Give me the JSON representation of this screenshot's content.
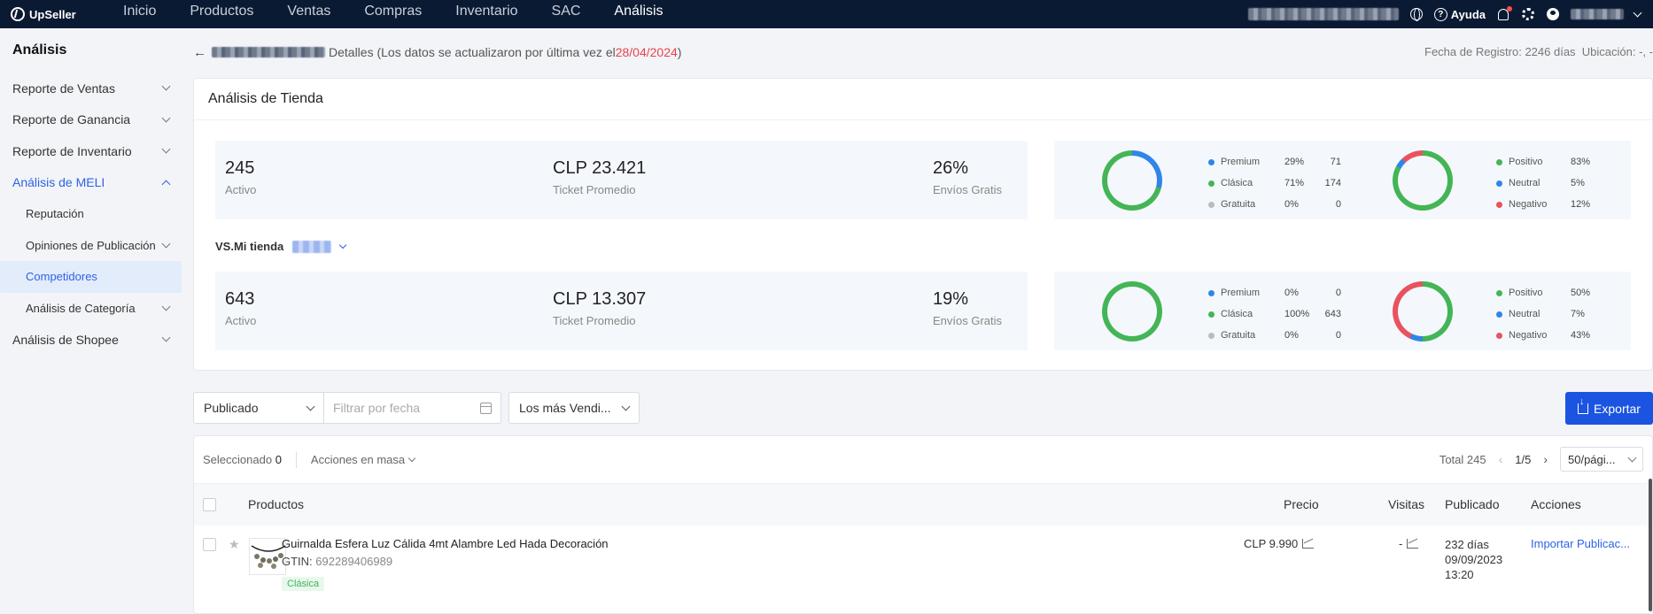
{
  "app": {
    "name": "UpSeller"
  },
  "nav": {
    "items": [
      "Inicio",
      "Productos",
      "Ventas",
      "Compras",
      "Inventario",
      "SAC",
      "Análisis"
    ],
    "active": "Análisis"
  },
  "top_right": {
    "help": "Ayuda"
  },
  "sidebar": {
    "title": "Análisis",
    "items": [
      {
        "label": "Reporte de Ventas"
      },
      {
        "label": "Reporte de Ganancia"
      },
      {
        "label": "Reporte de Inventario"
      },
      {
        "label": "Análisis de MELI"
      },
      {
        "label": "Reputación"
      },
      {
        "label": "Opiniones de Publicación"
      },
      {
        "label": "Competidores"
      },
      {
        "label": "Análisis de Categoría"
      },
      {
        "label": "Análisis de Shopee"
      }
    ]
  },
  "header": {
    "details_prefix": "Detalles (Los datos se actualizaron por última vez el ",
    "update_date": "28/04/2024",
    "details_suffix": ")",
    "registro": "Fecha de Registro: 2246 días",
    "ubicacion": "Ubicación: -, -"
  },
  "store": {
    "title": "Análisis de Tienda",
    "vs_label": "VS.Mi tienda",
    "competitor": {
      "active": "245",
      "active_label": "Activo",
      "ticket": "CLP 23.421",
      "ticket_label": "Ticket Promedio",
      "free": "26%",
      "free_label": "Envíos Gratis",
      "listing": [
        {
          "name": "Premium",
          "pct": "29%",
          "count": "71",
          "color": "#2f86e8"
        },
        {
          "name": "Clásica",
          "pct": "71%",
          "count": "174",
          "color": "#44b556"
        },
        {
          "name": "Gratuita",
          "pct": "0%",
          "count": "0",
          "color": "#bbbbbb"
        }
      ],
      "listing_fractions": [
        0.29,
        0.71,
        0
      ],
      "sentiment": [
        {
          "name": "Positivo",
          "pct": "83%",
          "color": "#44b556"
        },
        {
          "name": "Neutral",
          "pct": "5%",
          "color": "#2f86e8"
        },
        {
          "name": "Negativo",
          "pct": "12%",
          "color": "#e8535f"
        }
      ],
      "sentiment_fractions": [
        0.83,
        0.05,
        0.12
      ]
    },
    "mine": {
      "active": "643",
      "active_label": "Activo",
      "ticket": "CLP 13.307",
      "ticket_label": "Ticket Promedio",
      "free": "19%",
      "free_label": "Envíos Gratis",
      "listing": [
        {
          "name": "Premium",
          "pct": "0%",
          "count": "0",
          "color": "#2f86e8"
        },
        {
          "name": "Clásica",
          "pct": "100%",
          "count": "643",
          "color": "#44b556"
        },
        {
          "name": "Gratuita",
          "pct": "0%",
          "count": "0",
          "color": "#bbbbbb"
        }
      ],
      "listing_fractions": [
        0,
        1.0,
        0
      ],
      "sentiment": [
        {
          "name": "Positivo",
          "pct": "50%",
          "color": "#44b556"
        },
        {
          "name": "Neutral",
          "pct": "7%",
          "color": "#2f86e8"
        },
        {
          "name": "Negativo",
          "pct": "43%",
          "color": "#e8535f"
        }
      ],
      "sentiment_fractions": [
        0.5,
        0.07,
        0.43
      ]
    }
  },
  "filters": {
    "status": "Publicado",
    "date_placeholder": "Filtrar por fecha",
    "sort": "Los más Vendi...",
    "export": "Exportar"
  },
  "table": {
    "selected_label": "Seleccionado",
    "selected_count": "0",
    "mass_actions": "Acciones en masa",
    "total": "Total 245",
    "page": "1/5",
    "per_page": "50/pági...",
    "columns": {
      "products": "Productos",
      "price": "Precio",
      "visits": "Visitas",
      "published": "Publicado",
      "actions": "Acciones"
    },
    "rows": [
      {
        "title": "Guirnalda Esfera Luz Cálida 4mt Alambre Led Hada Decoración",
        "gtin_label": "GTIN:",
        "gtin": "692289406989",
        "tag": "Clásica",
        "price": "CLP 9.990",
        "visits": "-",
        "published_days": "232 días",
        "published_date": "09/09/2023",
        "published_time": "13:20",
        "action": "Importar Publicac..."
      }
    ]
  }
}
